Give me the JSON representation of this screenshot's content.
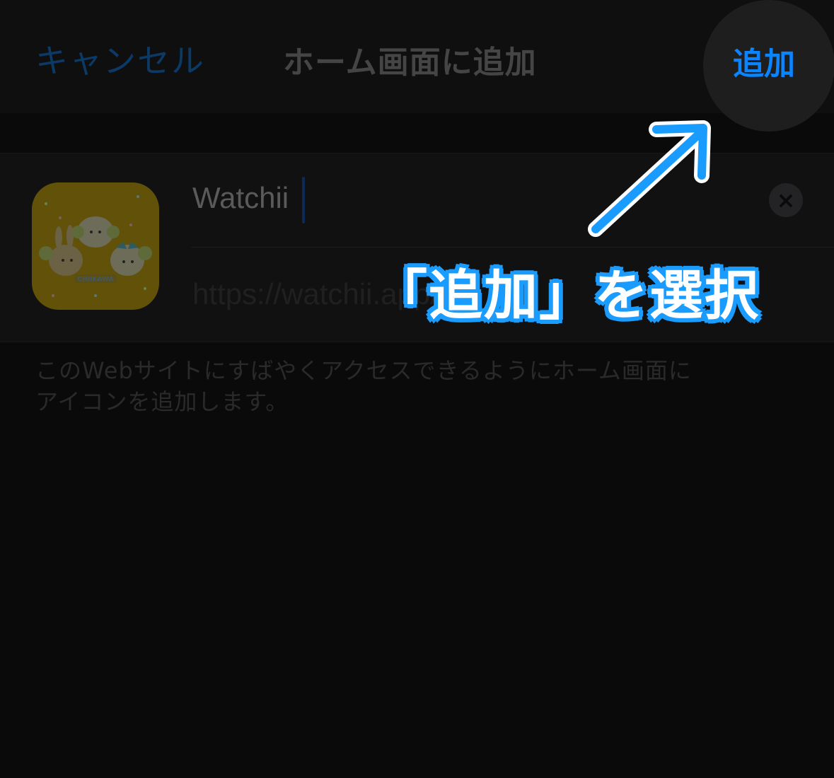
{
  "nav": {
    "cancel_label": "キャンセル",
    "title": "ホーム画面に追加",
    "add_label": "追加"
  },
  "form": {
    "name_value": "Watchii",
    "url_value": "https://watchii.app/",
    "clear_icon": "clear-icon"
  },
  "app_icon": {
    "caption": "CHIIKAWA"
  },
  "description": {
    "line1": "このWebサイトにすばやくアクセスできるようにホーム画面に",
    "line2": "アイコンを追加します。"
  },
  "annotation": {
    "callout_text": "「追加」を選択"
  },
  "colors": {
    "accent": "#0a84ff",
    "annotation_blue": "#1a9cff",
    "background": "#0a0a0a",
    "icon_yellow": "#625209"
  }
}
